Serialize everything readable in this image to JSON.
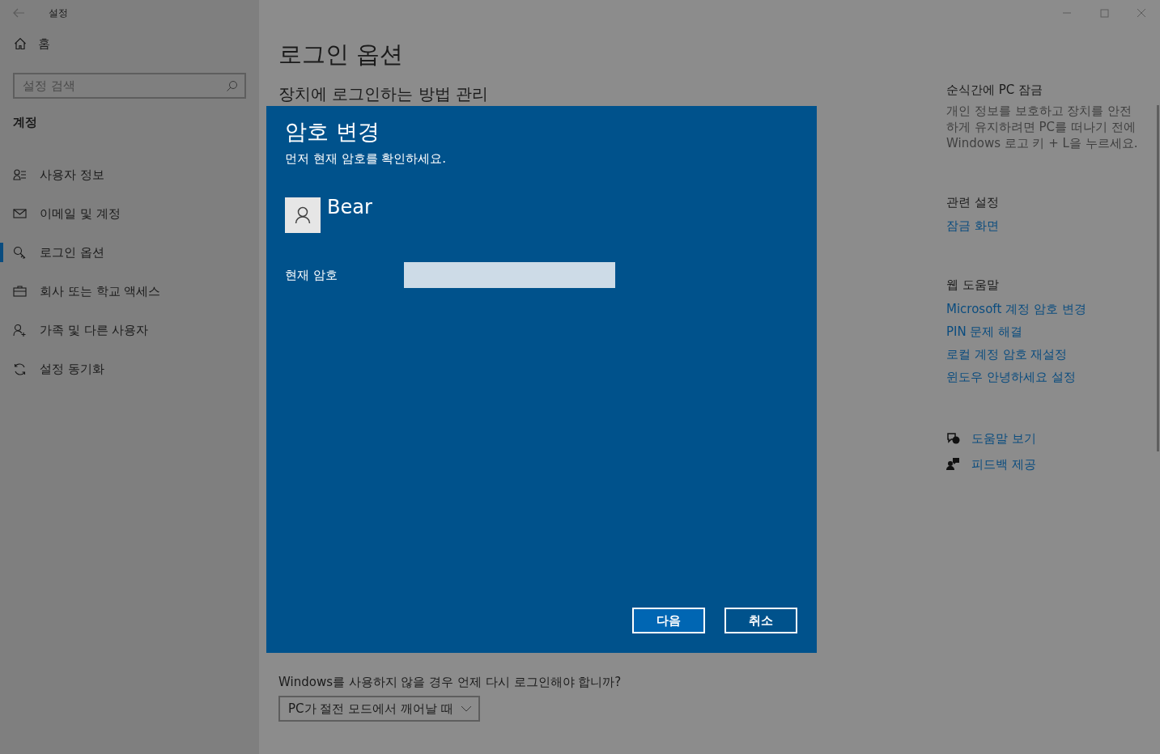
{
  "window": {
    "title": "설정"
  },
  "sidebar": {
    "home": "홈",
    "search": {
      "placeholder": "설정 검색"
    },
    "section": "계정",
    "items": [
      {
        "label": "사용자 정보",
        "kind": "info",
        "selected": false
      },
      {
        "label": "이메일 및 계정",
        "kind": "email",
        "selected": false
      },
      {
        "label": "로그인 옵션",
        "kind": "signin",
        "selected": true
      },
      {
        "label": "회사 또는 학교 액세스",
        "kind": "work",
        "selected": false
      },
      {
        "label": "가족 및 다른 사용자",
        "kind": "family",
        "selected": false
      },
      {
        "label": "설정 동기화",
        "kind": "sync",
        "selected": false
      }
    ]
  },
  "main": {
    "title": "로그인 옵션",
    "subtitle": "장치에 로그인하는 방법 관리",
    "question": "Windows를 사용하지 않을 경우 언제 다시 로그인해야 합니까?",
    "dropdown": {
      "value": "PC가 절전 모드에서 깨어날 때"
    }
  },
  "aside": {
    "lock": {
      "title": "순식간에 PC 잠금",
      "text": "개인 정보를 보호하고 장치를 안전하게 유지하려면 PC를 떠나기 전에 Windows 로고 키 + L을 누르세요."
    },
    "related": {
      "title": "관련 설정",
      "links": [
        "잠금 화면"
      ]
    },
    "web_help": {
      "title": "웹 도움말",
      "links": [
        "Microsoft 계정 암호 변경",
        "PIN 문제 해결",
        "로컬 계정 암호 재설정",
        "윈도우 안녕하세요 설정"
      ]
    },
    "actions": [
      {
        "label": "도움말 보기",
        "kind": "help"
      },
      {
        "label": "피드백 제공",
        "kind": "feedback"
      }
    ]
  },
  "dialog": {
    "title": "암호 변경",
    "instruction": "먼저 현재 암호를 확인하세요.",
    "user": "Bear",
    "field_label": "현재 암호",
    "buttons": [
      "다음",
      "취소"
    ]
  }
}
